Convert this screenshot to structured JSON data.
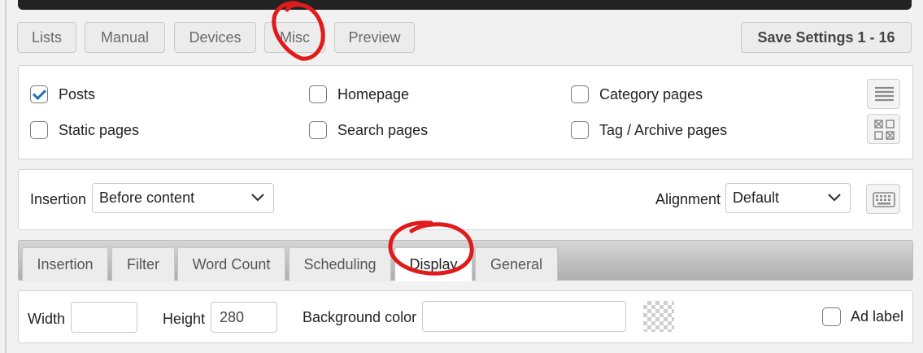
{
  "top_tabs": [
    {
      "label": "Lists"
    },
    {
      "label": "Manual"
    },
    {
      "label": "Devices"
    },
    {
      "label": "Misc"
    },
    {
      "label": "Preview"
    }
  ],
  "save_button": "Save Settings 1 - 16",
  "page_types": {
    "posts": {
      "label": "Posts",
      "checked": true
    },
    "static_pages": {
      "label": "Static pages",
      "checked": false
    },
    "homepage": {
      "label": "Homepage",
      "checked": false
    },
    "search_pages": {
      "label": "Search pages",
      "checked": false
    },
    "category_pages": {
      "label": "Category pages",
      "checked": false
    },
    "tag_archive_pages": {
      "label": "Tag / Archive pages",
      "checked": false
    }
  },
  "insertion": {
    "label": "Insertion",
    "value": "Before content"
  },
  "alignment": {
    "label": "Alignment",
    "value": "Default"
  },
  "sub_tabs": [
    {
      "label": "Insertion"
    },
    {
      "label": "Filter"
    },
    {
      "label": "Word Count"
    },
    {
      "label": "Scheduling"
    },
    {
      "label": "Display",
      "active": true
    },
    {
      "label": "General"
    }
  ],
  "display": {
    "width_label": "Width",
    "width_value": "",
    "height_label": "Height",
    "height_value": "280",
    "background_label": "Background color",
    "background_value": "",
    "ad_label": "Ad label"
  },
  "colors": {
    "annotation": "#e01b1b",
    "checkbox_check": "#2271b1"
  }
}
